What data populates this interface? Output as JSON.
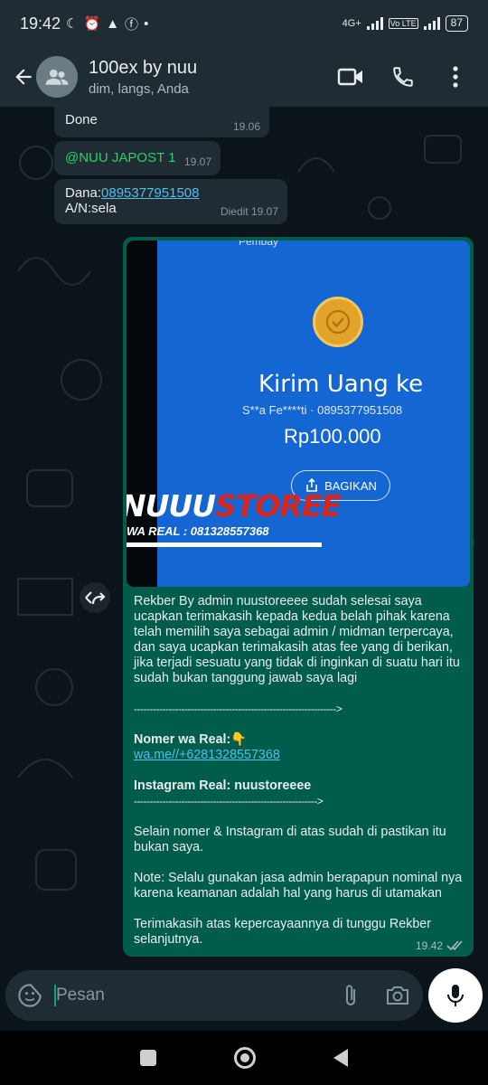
{
  "status_bar": {
    "time": "19:42",
    "network": "4G+",
    "volte": "Vo LTE",
    "battery": "87"
  },
  "header": {
    "title": "100ex by nuu",
    "subtitle": "dim, langs, Anda"
  },
  "messages": [
    {
      "text": "Done",
      "time": "19.06"
    },
    {
      "mention": "@NUU JAPOST 1",
      "time": "19.07"
    },
    {
      "label": "Dana:",
      "phone": "0895377951508",
      "line2": "A/N:sela",
      "edited": "Diedit",
      "time": "19.07"
    }
  ],
  "image_message": {
    "partial_top": "Pembay",
    "heading": "Kirim Uang ke",
    "recipient": "S**a Fe****ti · 0895377951508",
    "amount": "Rp100.000",
    "share_label": "BAGIKAN",
    "watermark_white": "NUUU",
    "watermark_red": "STOREE",
    "watermark_sub": "WA REAL : 081328557368"
  },
  "outgoing": {
    "p1": "Rekber By admin nuustoreeee sudah selesai saya ucapkan terimakasih kepada kedua belah pihak karena telah memilih saya sebagai admin / midman terpercaya, dan saya ucapkan terimakasih atas fee yang di berikan, jika terjadi sesuatu yang tidak di inginkan di suatu hari itu sudah bukan tanggung jawab saya lagi",
    "separator1": "---------------------------------------------------------------->",
    "wa_label": "Nomer wa Real:",
    "wa_emoji": "👇",
    "wa_link": "wa.me//+6281328557368",
    "ig_label": "Instagram Real: nuustoreeee",
    "separator2": "---------------------------------------------------------->",
    "p2": "Selain nomer & Instagram di atas sudah di pastikan itu bukan saya.",
    "p3": "Note: Selalu gunakan jasa admin berapapun nominal nya karena keamanan adalah hal yang harus di utamakan",
    "p4": "Terimakasih atas kepercayaannya di tunggu Rekber selanjutnya.",
    "time": "19.42"
  },
  "input": {
    "placeholder": "Pesan"
  },
  "icons": [
    "back-arrow-icon",
    "group-avatar-icon",
    "video-call-icon",
    "voice-call-icon",
    "more-options-icon",
    "forward-icon",
    "sticker-icon",
    "attach-icon",
    "camera-icon",
    "mic-icon",
    "double-check-icon"
  ],
  "colors": {
    "bubble_out": "#005c4b",
    "bubble_in": "#202c33",
    "link": "#53bdeb",
    "mention": "#25d366",
    "header": "#1f2c33"
  }
}
